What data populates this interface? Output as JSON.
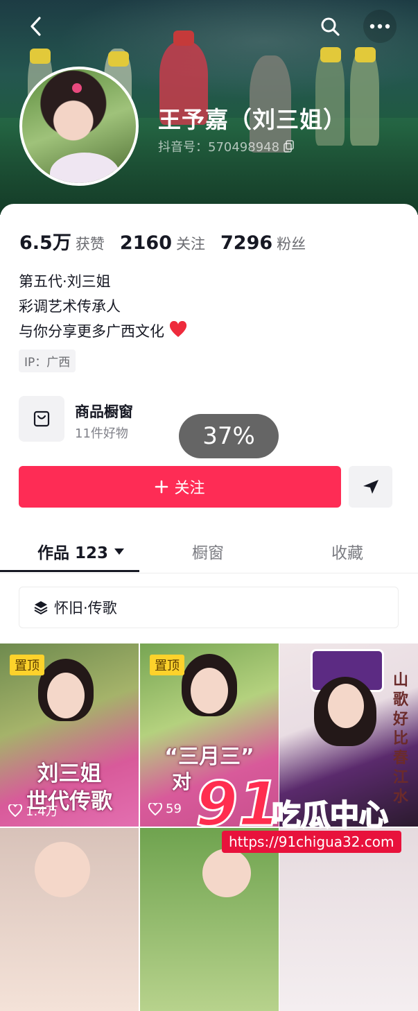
{
  "header": {
    "display_name": "王予嘉（刘三姐）",
    "douyin_id": "抖音号：570498948"
  },
  "stats": [
    {
      "value": "6.5万",
      "label": "获赞"
    },
    {
      "value": "2160",
      "label": "关注"
    },
    {
      "value": "7296",
      "label": "粉丝"
    }
  ],
  "bio": {
    "line1": "第五代·刘三姐",
    "line2": "彩调艺术传承人",
    "line3": "与你分享更多广西文化"
  },
  "ip_tag": "IP：广西",
  "shop": {
    "title": "商品橱窗",
    "subtitle": "11件好物"
  },
  "progress_toast": "37%",
  "progress_value": 37,
  "actions": {
    "follow_label": "关注"
  },
  "tabs": {
    "works_label": "作品 123",
    "shop_label": "橱窗",
    "favorites_label": "收藏"
  },
  "collection_label": "怀旧·传歌",
  "videos": [
    {
      "pinned": "置顶",
      "caption_line1": "刘三姐",
      "caption_line2": "世代传歌",
      "likes": "1.4万"
    },
    {
      "pinned": "置顶",
      "caption_line1": "“三月三”",
      "caption_line2": "对",
      "likes": "59"
    },
    {
      "side_text": "山歌好比春江水"
    }
  ],
  "watermark": {
    "number": "91",
    "text": "吃瓜中心",
    "url": "https://91chigua32.com"
  },
  "colors": {
    "accent": "#fe2c55",
    "pinned_badge": "#fdd22b"
  },
  "icons": [
    "back-icon",
    "search-icon",
    "more-icon",
    "copy-icon",
    "heart-icon",
    "shopping-bag-icon",
    "plus-icon",
    "share-icon",
    "caret-down-icon",
    "layers-icon",
    "like-icon"
  ]
}
